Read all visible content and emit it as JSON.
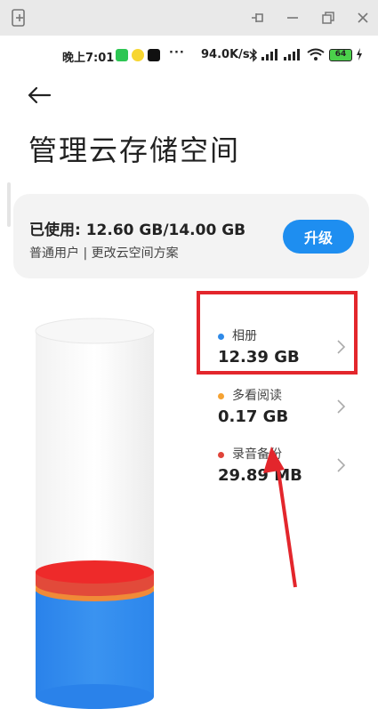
{
  "window": {
    "icons": [
      "new-window-icon",
      "pin-icon",
      "minimize-icon",
      "restore-icon",
      "close-icon"
    ]
  },
  "status_bar": {
    "time": "晚上7:01",
    "dots": "···",
    "net_speed": "94.0K/s",
    "battery": "64"
  },
  "header": {
    "back_icon": "arrow-left-icon",
    "title": "管理云存储空间"
  },
  "usage": {
    "label": "已使用: 12.60 GB/14.00 GB",
    "sub": "普通用户 | 更改云空间方案",
    "upgrade_label": "升级"
  },
  "storage": {
    "used_fraction": 0.9,
    "items": [
      {
        "label": "相册",
        "value": "12.39 GB",
        "color": "#2f8ae8"
      },
      {
        "label": "多看阅读",
        "value": "0.17 GB",
        "color": "#f5a233"
      },
      {
        "label": "录音备份",
        "value": "29.89 MB",
        "color": "#e0443a"
      }
    ]
  },
  "colors": {
    "accent": "#1e8ef0",
    "highlight": "#e3262c"
  }
}
